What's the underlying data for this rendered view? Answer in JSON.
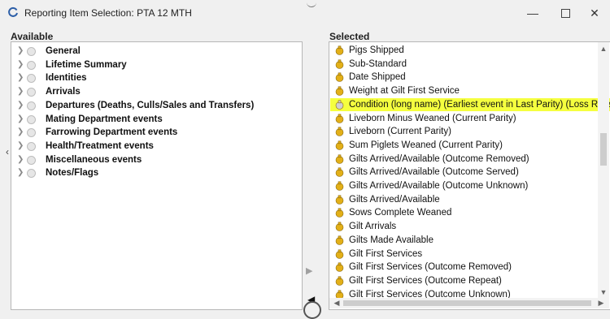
{
  "window": {
    "title": "Reporting Item Selection: PTA 12 MTH",
    "minimize_glyph": "—",
    "close_glyph": "✕"
  },
  "available": {
    "label": "Available",
    "items": [
      {
        "label": "General"
      },
      {
        "label": "Lifetime Summary"
      },
      {
        "label": "Identities"
      },
      {
        "label": "Arrivals"
      },
      {
        "label": "Departures (Deaths, Culls/Sales and Transfers)"
      },
      {
        "label": "Mating Department events"
      },
      {
        "label": "Farrowing Department events"
      },
      {
        "label": "Health/Treatment events"
      },
      {
        "label": "Miscellaneous events"
      },
      {
        "label": "Notes/Flags"
      }
    ]
  },
  "selected": {
    "label": "Selected",
    "items": [
      {
        "label": "Pigs Shipped",
        "icon": "yellow",
        "highlight": false
      },
      {
        "label": "Sub-Standard",
        "icon": "yellow",
        "highlight": false
      },
      {
        "label": "Date Shipped",
        "icon": "yellow",
        "highlight": false
      },
      {
        "label": "Weight at Gilt First Service",
        "icon": "yellow",
        "highlight": false
      },
      {
        "label": "Condition (long name)  (Earliest event in Last Parity) (Loss Reasc",
        "icon": "grey",
        "highlight": true
      },
      {
        "label": "Liveborn Minus Weaned  (Current Parity)",
        "icon": "yellow",
        "highlight": false
      },
      {
        "label": "Liveborn  (Current Parity)",
        "icon": "yellow",
        "highlight": false
      },
      {
        "label": "Sum Piglets Weaned  (Current Parity)",
        "icon": "yellow",
        "highlight": false
      },
      {
        "label": "Gilts Arrived/Available (Outcome Removed)",
        "icon": "yellow",
        "highlight": false
      },
      {
        "label": "Gilts Arrived/Available (Outcome Served)",
        "icon": "yellow",
        "highlight": false
      },
      {
        "label": "Gilts Arrived/Available (Outcome Unknown)",
        "icon": "yellow",
        "highlight": false
      },
      {
        "label": "Gilts Arrived/Available",
        "icon": "yellow",
        "highlight": false
      },
      {
        "label": "Sows Complete Weaned",
        "icon": "yellow",
        "highlight": false
      },
      {
        "label": "Gilt Arrivals",
        "icon": "yellow",
        "highlight": false
      },
      {
        "label": "Gilts Made Available",
        "icon": "yellow",
        "highlight": false
      },
      {
        "label": "Gilt First Services",
        "icon": "yellow",
        "highlight": false
      },
      {
        "label": "Gilt First Services (Outcome Removed)",
        "icon": "yellow",
        "highlight": false
      },
      {
        "label": "Gilt First Services (Outcome Repeat)",
        "icon": "yellow",
        "highlight": false
      },
      {
        "label": "Gilt First Services (Outcome Unknown)",
        "icon": "yellow",
        "highlight": false
      }
    ]
  },
  "colors": {
    "highlight": "#f5ff3f",
    "icon_yellow": "#e3b018",
    "icon_grey": "#cfcfcf"
  }
}
